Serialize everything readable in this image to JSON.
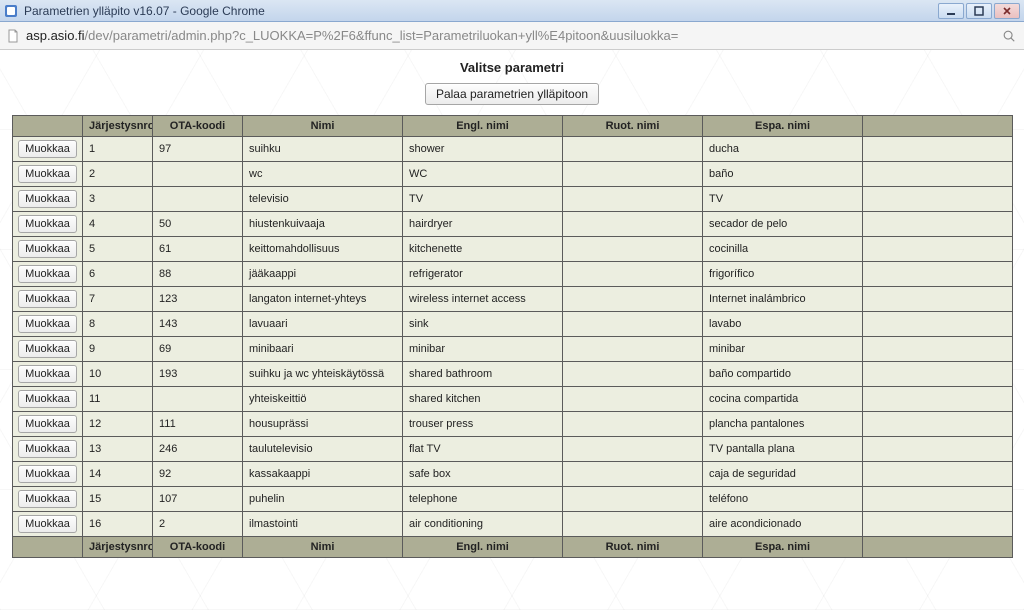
{
  "window": {
    "title": "Parametrien ylläpito v16.07 - Google Chrome"
  },
  "address": {
    "host": "asp.asio.fi",
    "path": "/dev/parametri/admin.php?c_LUOKKA=P%2F6&ffunc_list=Parametriluokan+yll%E4pitoon&uusiluokka="
  },
  "page": {
    "heading": "Valitse parametri",
    "back_button": "Palaa parametrien ylläpitoon",
    "edit_button": "Muokkaa",
    "columns": {
      "action": "",
      "jarjestysnro": "Järjestysnro",
      "ota_koodi": "OTA-koodi",
      "nimi": "Nimi",
      "engl_nimi": "Engl. nimi",
      "ruot_nimi": "Ruot. nimi",
      "espa_nimi": "Espa. nimi",
      "last": ""
    },
    "rows": [
      {
        "n": "1",
        "ota": "97",
        "nimi": "suihku",
        "en": "shower",
        "sv": "",
        "es": "ducha"
      },
      {
        "n": "2",
        "ota": "",
        "nimi": "wc",
        "en": "WC",
        "sv": "",
        "es": "baño"
      },
      {
        "n": "3",
        "ota": "",
        "nimi": "televisio",
        "en": "TV",
        "sv": "",
        "es": "TV"
      },
      {
        "n": "4",
        "ota": "50",
        "nimi": "hiustenkuivaaja",
        "en": "hairdryer",
        "sv": "",
        "es": "secador de pelo"
      },
      {
        "n": "5",
        "ota": "61",
        "nimi": "keittomahdollisuus",
        "en": "kitchenette",
        "sv": "",
        "es": "cocinilla"
      },
      {
        "n": "6",
        "ota": "88",
        "nimi": "jääkaappi",
        "en": "refrigerator",
        "sv": "",
        "es": "frigorífico"
      },
      {
        "n": "7",
        "ota": "123",
        "nimi": "langaton internet-yhteys",
        "en": "wireless internet access",
        "sv": "",
        "es": "Internet inalámbrico"
      },
      {
        "n": "8",
        "ota": "143",
        "nimi": "lavuaari",
        "en": "sink",
        "sv": "",
        "es": "lavabo"
      },
      {
        "n": "9",
        "ota": "69",
        "nimi": "minibaari",
        "en": "minibar",
        "sv": "",
        "es": "minibar"
      },
      {
        "n": "10",
        "ota": "193",
        "nimi": "suihku ja wc yhteiskäytössä",
        "en": "shared bathroom",
        "sv": "",
        "es": "baño compartido"
      },
      {
        "n": "11",
        "ota": "",
        "nimi": "yhteiskeittiö",
        "en": "shared kitchen",
        "sv": "",
        "es": "cocina compartida"
      },
      {
        "n": "12",
        "ota": "111",
        "nimi": "housuprässi",
        "en": "trouser press",
        "sv": "",
        "es": "plancha pantalones"
      },
      {
        "n": "13",
        "ota": "246",
        "nimi": "taulutelevisio",
        "en": "flat TV",
        "sv": "",
        "es": "TV pantalla plana"
      },
      {
        "n": "14",
        "ota": "92",
        "nimi": "kassakaappi",
        "en": "safe box",
        "sv": "",
        "es": "caja de seguridad"
      },
      {
        "n": "15",
        "ota": "107",
        "nimi": "puhelin",
        "en": "telephone",
        "sv": "",
        "es": "teléfono"
      },
      {
        "n": "16",
        "ota": "2",
        "nimi": "ilmastointi",
        "en": "air conditioning",
        "sv": "",
        "es": "aire acondicionado"
      }
    ]
  }
}
